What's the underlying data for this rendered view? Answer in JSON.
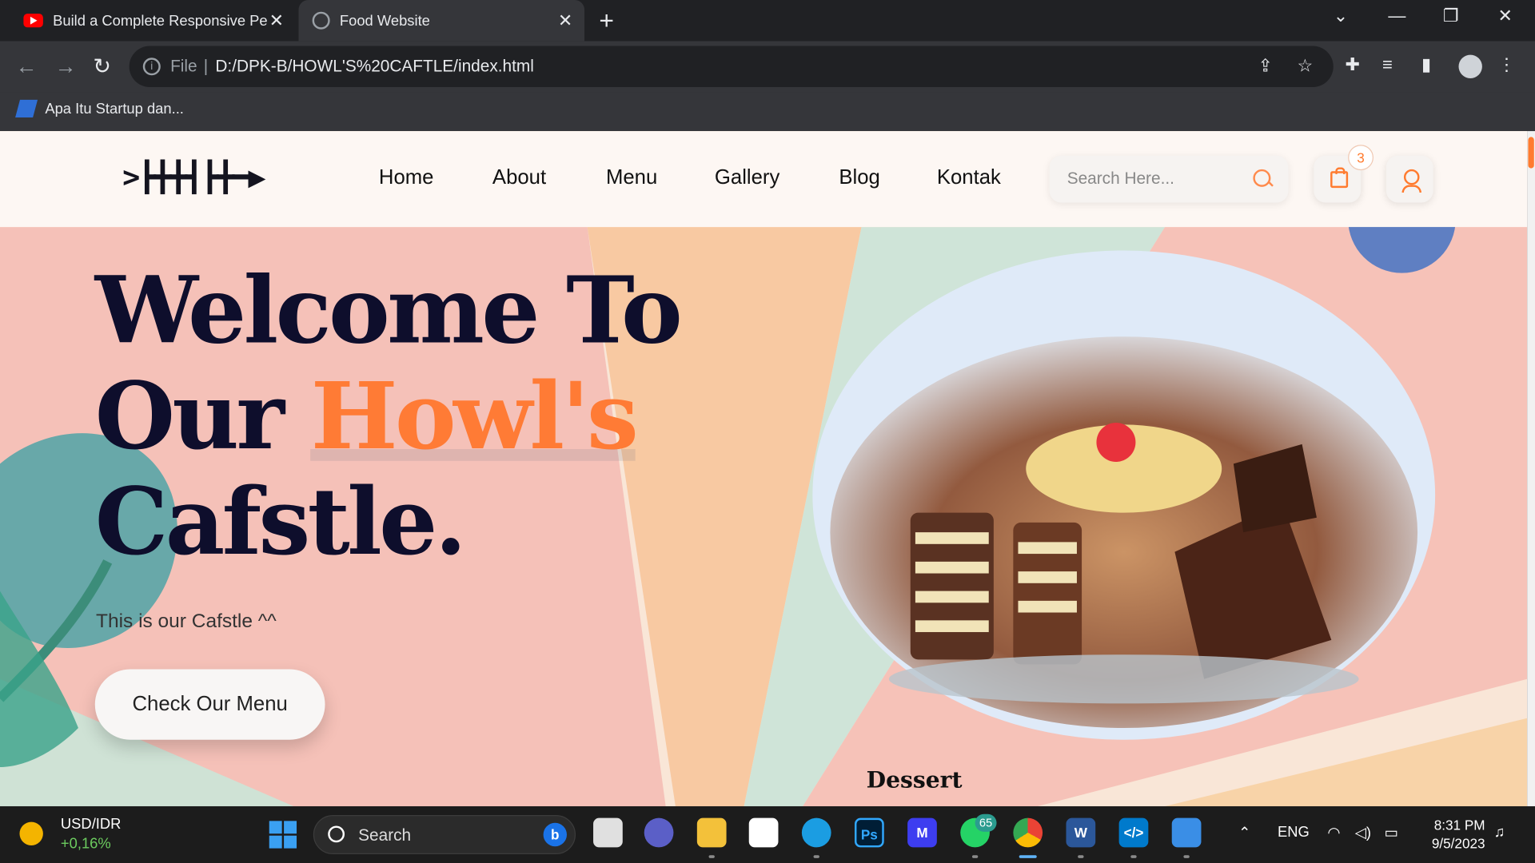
{
  "browser": {
    "tabs": [
      {
        "title": "Build a Complete Responsive Per",
        "active": false,
        "icon": "youtube-icon"
      },
      {
        "title": "Food Website",
        "active": true,
        "icon": "globe-icon"
      }
    ],
    "address": {
      "scheme_label": "File",
      "url": "D:/DPK-B/HOWL'S%20CAFTLE/index.html"
    },
    "bookmarks": [
      {
        "label": "Apa Itu Startup dan..."
      }
    ]
  },
  "site": {
    "logo_text": ">┣╋╋┫┣╋━▶",
    "nav": [
      "Home",
      "About",
      "Menu",
      "Gallery",
      "Blog",
      "Kontak"
    ],
    "search_placeholder": "Search Here...",
    "cart_count": "3",
    "accent": "#ff7b35"
  },
  "hero": {
    "line1": "Welcome To",
    "line2_prefix": "Our ",
    "line2_highlight": "Howl's",
    "line3": "Cafstle.",
    "subtitle": "This is our Cafstle ^^",
    "cta_label": "Check Our Menu",
    "image_caption": "Dessert"
  },
  "taskbar": {
    "ticker_pair": "USD/IDR",
    "ticker_change": "+0,16%",
    "search_label": "Search",
    "whatsapp_badge": "65",
    "language": "ENG",
    "time": "8:31 PM",
    "date": "9/5/2023"
  }
}
